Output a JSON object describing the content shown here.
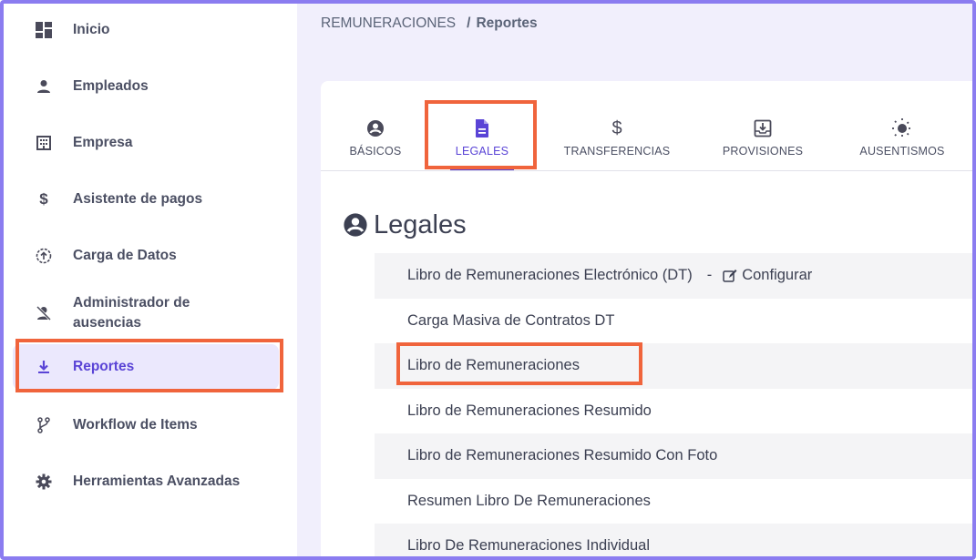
{
  "sidebar": {
    "items": [
      {
        "label": "Inicio",
        "icon": "dashboard-icon"
      },
      {
        "label": "Empleados",
        "icon": "person-icon"
      },
      {
        "label": "Empresa",
        "icon": "building-icon"
      },
      {
        "label": "Asistente de pagos",
        "icon": "dollar-icon"
      },
      {
        "label": "Carga de Datos",
        "icon": "upload-circle-icon"
      },
      {
        "label": "Administrador de ausencias",
        "icon": "person-off-icon"
      },
      {
        "label": "Reportes",
        "icon": "download-icon",
        "active": true
      },
      {
        "label": "Workflow de Items",
        "icon": "branch-icon"
      },
      {
        "label": "Herramientas Avanzadas",
        "icon": "gear-icon"
      }
    ]
  },
  "breadcrumb": {
    "parent": "REMUNERACIONES",
    "separator": "/",
    "current": "Reportes"
  },
  "tabs": [
    {
      "label": "BÁSICOS",
      "icon": "account-circle-icon"
    },
    {
      "label": "LEGALES",
      "icon": "document-icon",
      "active": true
    },
    {
      "label": "TRANSFERENCIAS",
      "icon": "dollar-icon"
    },
    {
      "label": "PROVISIONES",
      "icon": "tray-download-icon"
    },
    {
      "label": "AUSENTISMOS",
      "icon": "sun-icon"
    }
  ],
  "section": {
    "title": "Legales",
    "icon": "account-circle-icon"
  },
  "reports": [
    {
      "label": "Libro de Remuneraciones Electrónico (DT)",
      "separator": "-",
      "action": "Configurar"
    },
    {
      "label": "Carga Masiva de Contratos DT"
    },
    {
      "label": "Libro de Remuneraciones"
    },
    {
      "label": "Libro de Remuneraciones Resumido"
    },
    {
      "label": "Libro de Remuneraciones Resumido Con Foto"
    },
    {
      "label": "Resumen Libro De Remuneraciones"
    },
    {
      "label": "Libro De Remuneraciones Individual"
    }
  ],
  "colors": {
    "accent": "#5a44d6",
    "highlight": "#f0643c",
    "frame": "#8b7cf0",
    "main_bg": "#f1effc"
  }
}
